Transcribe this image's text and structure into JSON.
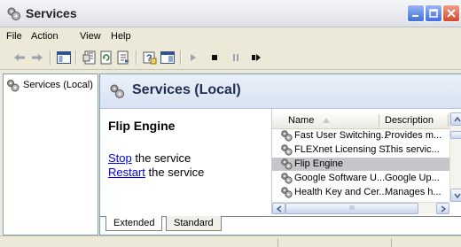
{
  "window": {
    "title": "Services"
  },
  "menu": {
    "items": [
      "File",
      "Action",
      "View",
      "Help"
    ]
  },
  "toolbar": {
    "buttons": [
      "back-arrow-icon",
      "forward-arrow-icon",
      "show-hide-tree-icon",
      "properties-icon",
      "refresh-icon",
      "export-list-icon",
      "help-icon",
      "console-view-icon",
      "start-service-icon",
      "stop-service-icon",
      "pause-service-icon",
      "restart-service-icon"
    ]
  },
  "tree": {
    "items": [
      {
        "label": "Services (Local)"
      }
    ]
  },
  "main": {
    "header": "Services (Local)",
    "selected_service": "Flip Engine",
    "actions": [
      {
        "link": "Stop",
        "rest": " the service"
      },
      {
        "link": "Restart",
        "rest": " the service"
      }
    ]
  },
  "list": {
    "columns": [
      "Name",
      "Description"
    ],
    "rows": [
      {
        "name": "Fast User Switching...",
        "description": "Provides m..."
      },
      {
        "name": "FLEXnet Licensing S...",
        "description": "This servic..."
      },
      {
        "name": "Flip Engine",
        "description": ""
      },
      {
        "name": "Google Software U...",
        "description": "Google Up..."
      },
      {
        "name": "Health Key and Cer...",
        "description": "Manages h..."
      }
    ],
    "selected_index": 2,
    "hscroll_label": "III"
  },
  "tabs": [
    "Extended",
    "Standard"
  ],
  "colors": {
    "selection": "#c5c6c9",
    "link": "#0000ee",
    "header_band": "#d8e2f1"
  }
}
